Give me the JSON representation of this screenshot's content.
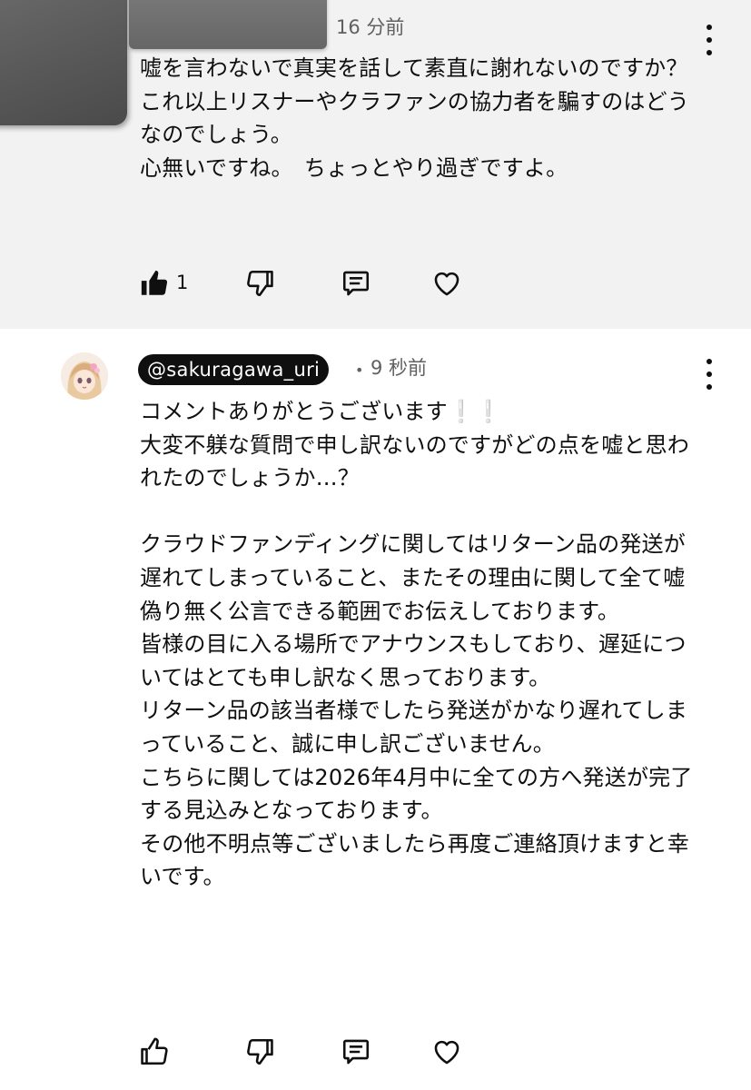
{
  "comments": [
    {
      "time": "16 分前",
      "text": "嘘を言わないで真実を話して素直に謝れないのですか？\nこれ以上リスナーやクラファンの協力者を騙すのはどうなのでしょう。\n心無いですね。　ちょっとやり過ぎですよ。",
      "like_count": "1",
      "liked": true
    },
    {
      "handle": "@sakuragawa_uri",
      "separator": "•",
      "time": "9 秒前",
      "text": "コメントありがとうございます❕❕\n大変不躾な質問で申し訳ないのですがどの点を嘘と思われたのでしょうか…？\n\nクラウドファンディングに関してはリターン品の発送が遅れてしまっていること、またその理由に関して全て嘘偽り無く公言できる範囲でお伝えしております。\n皆様の目に入る場所でアナウンスもしており、遅延についてはとても申し訳なく思っております。\nリターン品の該当者様でしたら発送がかなり遅れてしまっていること、誠に申し訳ございません。\nこちらに関しては2026年4月中に全ての方へ発送が完了する見込みとなっております。\nその他不明点等ございましたら再度ご連絡頂けますと幸いです。",
      "like_count": "",
      "liked": false
    }
  ],
  "icons": {
    "like": "thumbs-up-icon",
    "dislike": "thumbs-down-icon",
    "reply": "reply-comment-icon",
    "heart": "heart-icon",
    "more": "more-vertical-icon"
  },
  "colors": {
    "highlighted_bg": "#f2f2f2",
    "text": "#0f0f0f",
    "secondary": "#606060",
    "handle_badge": "#0f0f0f"
  }
}
